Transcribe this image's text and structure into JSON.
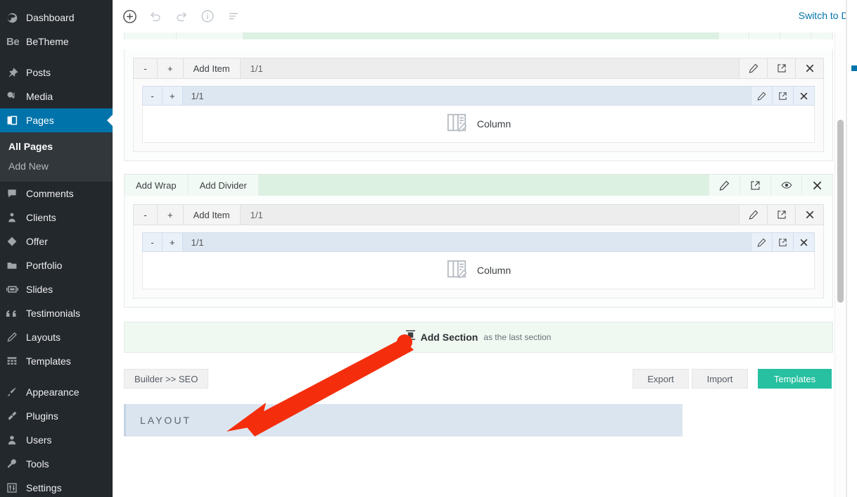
{
  "sidebar": {
    "items": [
      {
        "label": "Dashboard",
        "icon": "dashboard-icon",
        "active": false
      },
      {
        "label": "BeTheme",
        "icon": "betheme-logo-icon",
        "active": false
      },
      {
        "label": "Posts",
        "icon": "pin-icon",
        "active": false
      },
      {
        "label": "Media",
        "icon": "media-icon",
        "active": false
      },
      {
        "label": "Pages",
        "icon": "pages-icon",
        "active": true
      },
      {
        "label": "Comments",
        "icon": "comment-icon",
        "active": false
      },
      {
        "label": "Clients",
        "icon": "clients-icon",
        "active": false
      },
      {
        "label": "Offer",
        "icon": "offer-tag-icon",
        "active": false
      },
      {
        "label": "Portfolio",
        "icon": "portfolio-folder-icon",
        "active": false
      },
      {
        "label": "Slides",
        "icon": "slides-icon",
        "active": false
      },
      {
        "label": "Testimonials",
        "icon": "quote-icon",
        "active": false
      },
      {
        "label": "Layouts",
        "icon": "pencil-icon",
        "active": false
      },
      {
        "label": "Templates",
        "icon": "grid-icon",
        "active": false
      },
      {
        "label": "Appearance",
        "icon": "brush-icon",
        "active": false
      },
      {
        "label": "Plugins",
        "icon": "plug-icon",
        "active": false
      },
      {
        "label": "Users",
        "icon": "user-icon",
        "active": false
      },
      {
        "label": "Tools",
        "icon": "wrench-icon",
        "active": false
      },
      {
        "label": "Settings",
        "icon": "sliders-icon",
        "active": false
      }
    ],
    "submenu": {
      "all_pages": "All Pages",
      "add_new": "Add New"
    }
  },
  "toolbar": {
    "add_label": "add-circle-icon",
    "undo_label": "undo-icon",
    "redo_label": "redo-icon",
    "info_label": "info-icon",
    "list_label": "list-icon",
    "switch_to_draft": "Switch to Dra"
  },
  "builder": {
    "wrap_row": {
      "minus": "-",
      "plus": "+",
      "add_item": "Add Item",
      "ratio": "1/1"
    },
    "item_row": {
      "minus": "-",
      "plus": "+",
      "ratio": "1/1"
    },
    "column_label": "Column",
    "section_bar": {
      "add_wrap": "Add Wrap",
      "add_divider": "Add Divider"
    },
    "add_section": {
      "main": "Add Section",
      "sub": "as the last section"
    },
    "buttons": {
      "builder_seo": "Builder >> SEO",
      "export": "Export",
      "import": "Import",
      "templates": "Templates"
    }
  },
  "layout_panel": {
    "title": "LAYOUT"
  },
  "colors": {
    "sidebar_bg": "#23282d",
    "active_blue": "#0073aa",
    "section_green": "#ddf1e3",
    "item_blue": "#dde7f2",
    "templates_teal": "#27c0a0",
    "layout_panel_blue": "#dbe5f0",
    "arrow_red": "#f42e0c"
  }
}
